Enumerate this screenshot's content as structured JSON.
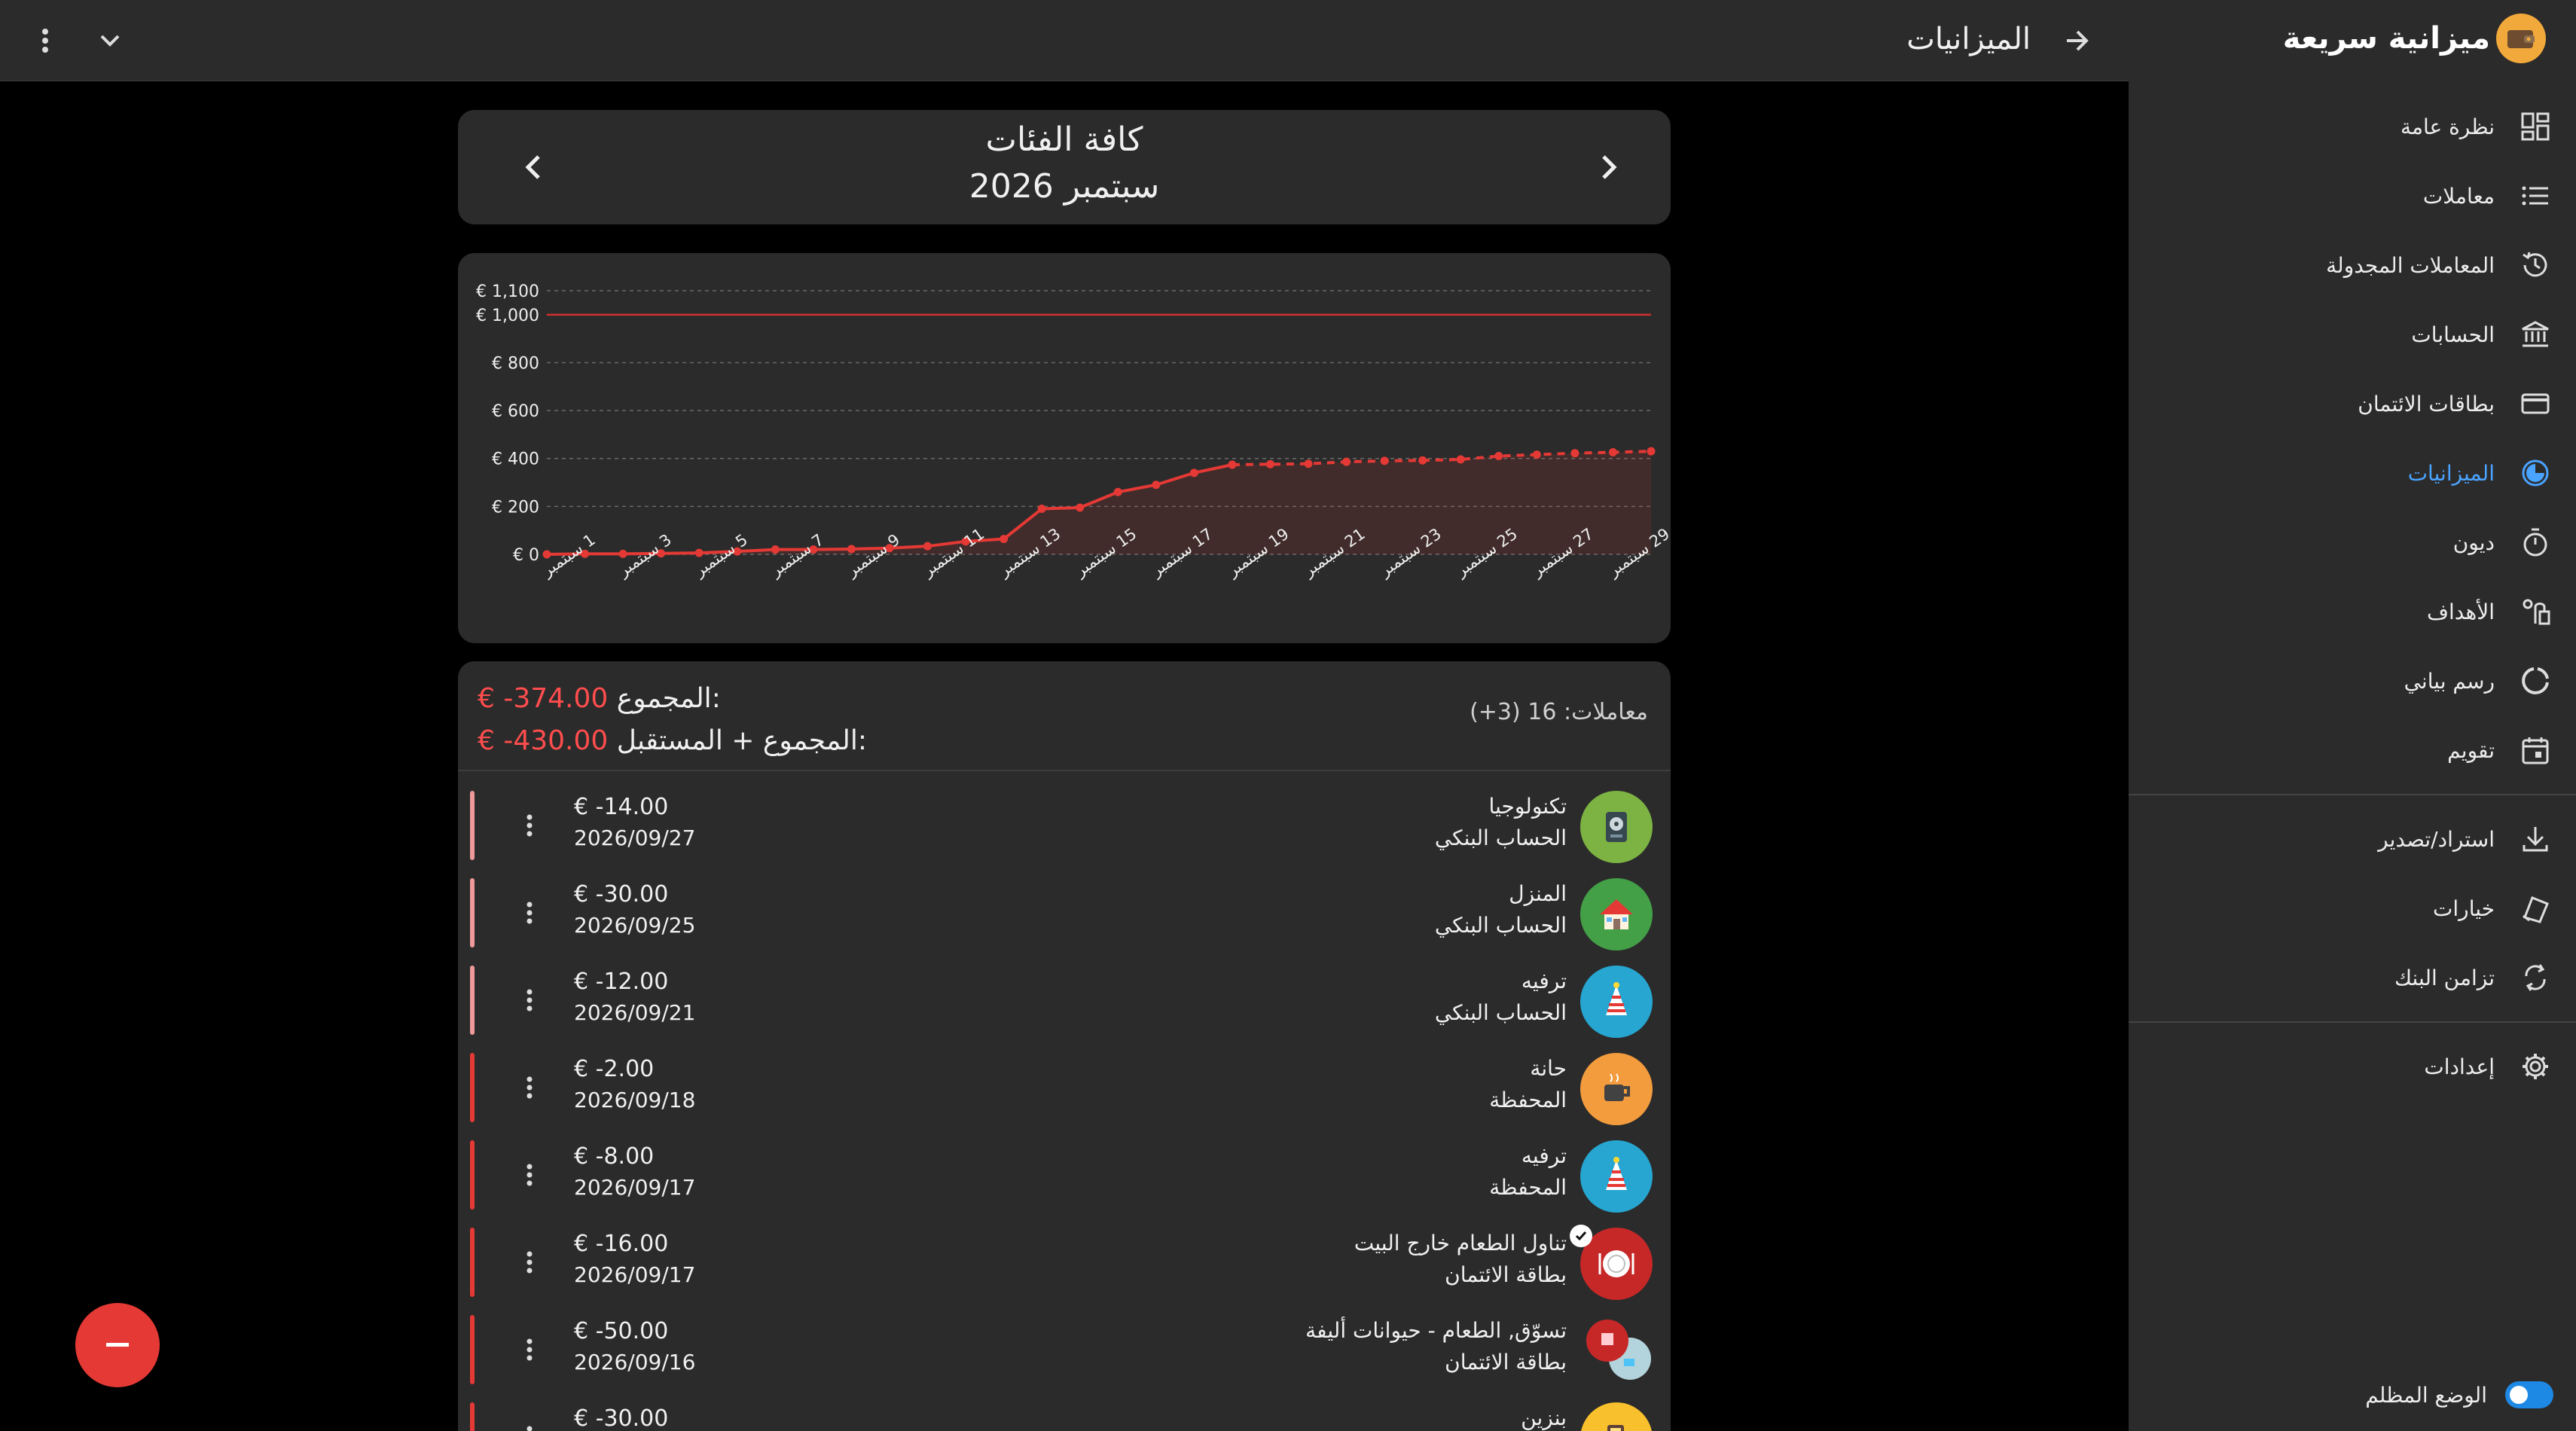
{
  "appbar": {
    "title": "الميزانيات"
  },
  "brand": {
    "name": "ميزانية سريعة"
  },
  "nav": {
    "items": [
      {
        "label": "نظرة عامة",
        "icon": "dashboard-icon"
      },
      {
        "label": "معاملات",
        "icon": "list-icon"
      },
      {
        "label": "المعاملات المجدولة",
        "icon": "scheduled-icon"
      },
      {
        "label": "الحسابات",
        "icon": "bank-icon"
      },
      {
        "label": "بطاقات الائتمان",
        "icon": "credit-card-icon"
      },
      {
        "label": "الميزانيات",
        "icon": "budget-pie-icon",
        "active": true
      },
      {
        "label": "ديون",
        "icon": "timer-icon"
      },
      {
        "label": "الأهداف",
        "icon": "goal-icon"
      },
      {
        "label": "رسم بياني",
        "icon": "chart-donut-icon"
      },
      {
        "label": "تقويم",
        "icon": "calendar-icon"
      }
    ],
    "items2": [
      {
        "label": "استراد/تصدير",
        "icon": "download-icon"
      },
      {
        "label": "خيارات",
        "icon": "options-icon"
      },
      {
        "label": "تزامن البنك",
        "icon": "sync-icon"
      }
    ],
    "settings": {
      "label": "إعدادات",
      "icon": "gear-icon"
    },
    "dark_mode_label": "الوضع المظلم",
    "accent": "#4aa3ff"
  },
  "period": {
    "category": "كافة الفئات",
    "month": "سبتمبر 2026"
  },
  "chart_data": {
    "type": "line",
    "x_tick_labels": [
      "1 سبتمبر",
      "3 سبتمبر",
      "5 سبتمبر",
      "7 سبتمبر",
      "9 سبتمبر",
      "11 سبتمبر",
      "13 سبتمبر",
      "15 سبتمبر",
      "17 سبتمبر",
      "19 سبتمبر",
      "21 سبتمبر",
      "23 سبتمبر",
      "25 سبتمبر",
      "27 سبتمبر",
      "29 سبتمبر"
    ],
    "y_tick_labels": [
      "€ 0",
      "€ 200",
      "€ 400",
      "€ 600",
      "€ 800",
      "€ 1,000",
      "€ 1,100"
    ],
    "y_ticks": [
      0,
      200,
      400,
      600,
      800,
      1000,
      1100
    ],
    "ylim": [
      0,
      1100
    ],
    "xlim": [
      1,
      30
    ],
    "budget_line": 1000,
    "series": [
      {
        "style": "actual",
        "x": [
          1,
          2,
          3,
          4,
          5,
          6,
          7,
          8,
          9,
          10,
          11,
          12,
          13,
          14,
          15,
          16,
          17,
          18,
          19
        ],
        "values": [
          0,
          2,
          2,
          4,
          6,
          12,
          20,
          20,
          22,
          26,
          34,
          54,
          64,
          190,
          195,
          260,
          290,
          340,
          374
        ]
      },
      {
        "style": "projected",
        "x": [
          19,
          20,
          21,
          22,
          23,
          24,
          25,
          26,
          27,
          28,
          29,
          30
        ],
        "values": [
          374,
          376,
          378,
          386,
          390,
          392,
          396,
          410,
          416,
          422,
          426,
          430
        ]
      }
    ],
    "colors": {
      "line": "#e53935",
      "budget": "#d32f2f",
      "grid": "#6a6a6a"
    }
  },
  "summary": {
    "total_label": "المجموع:",
    "total_value": "€ -374.00",
    "total_future_label": "المجموع + المستقبل:",
    "total_future_value": "€ -430.00",
    "transactions_count": "معاملات: 16 (3+)"
  },
  "transactions": [
    {
      "amount": "€ -14.00",
      "date": "2026/09/27",
      "category": "تكنولوجيا",
      "account": "الحساب البنكي",
      "icon": "hard-drive-icon",
      "avatar_color": "#7cb342",
      "bar_color": "#ef9a9a",
      "checked": false
    },
    {
      "amount": "€ -30.00",
      "date": "2026/09/25",
      "category": "المنزل",
      "account": "الحساب البنكي",
      "icon": "house-icon",
      "avatar_color": "#43a047",
      "bar_color": "#ef9a9a",
      "checked": false
    },
    {
      "amount": "€ -12.00",
      "date": "2026/09/21",
      "category": "ترفيه",
      "account": "الحساب البنكي",
      "icon": "party-hat-icon",
      "avatar_color": "#26a6d1",
      "bar_color": "#ef9a9a",
      "checked": false
    },
    {
      "amount": "€ -2.00",
      "date": "2026/09/18",
      "category": "حانة",
      "account": "المحفظة",
      "icon": "coffee-cup-icon",
      "avatar_color": "#f39c3d",
      "bar_color": "#e53935",
      "checked": false
    },
    {
      "amount": "€ -8.00",
      "date": "2026/09/17",
      "category": "ترفيه",
      "account": "المحفظة",
      "icon": "party-hat-icon",
      "avatar_color": "#26a6d1",
      "bar_color": "#e53935",
      "checked": false
    },
    {
      "amount": "€ -16.00",
      "date": "2026/09/17",
      "category": "تناول الطعام خارج البيت",
      "account": "بطاقة الائتمان",
      "icon": "plate-icon",
      "avatar_color": "#c62828",
      "bar_color": "#e53935",
      "checked": true
    },
    {
      "amount": "€ -50.00",
      "date": "2026/09/16",
      "category": "تسوّق, الطعام - حيوانات أليفة",
      "account": "بطاقة الائتمان",
      "icon": "multi-category-icon",
      "avatar_color": "#2b2b2b",
      "bar_color": "#e53935",
      "checked": false
    },
    {
      "amount": "€ -30.00",
      "date": "",
      "category": "بنزين",
      "account": "",
      "icon": "fuel-icon",
      "avatar_color": "#f9c02d",
      "bar_color": "#e53935",
      "checked": false
    }
  ]
}
